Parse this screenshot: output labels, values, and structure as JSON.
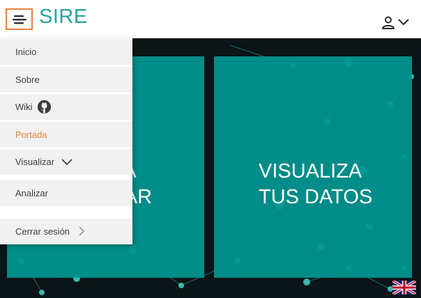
{
  "header": {
    "brand": "SIRE",
    "menu_icon": "hamburger-menu-icon",
    "user_icon": "user-icon",
    "user_dropdown_icon": "chevron-down-icon",
    "accent_color": "#e8833a",
    "brand_color": "#2aa1a1"
  },
  "side_menu": {
    "items": [
      {
        "label": "Inicio"
      },
      {
        "label": "Sobre"
      },
      {
        "label": "Wiki",
        "icon": "github-icon"
      },
      {
        "label": "Portada",
        "active": true
      },
      {
        "label": "Visualizar",
        "icon": "chevron-down-icon"
      },
      {
        "label": "Analizar"
      },
      {
        "label": "Cerrar sesión",
        "icon": "chevron-right-icon"
      }
    ]
  },
  "tiles": {
    "left": {
      "line1": "A A",
      "line2": "IZAR"
    },
    "right": {
      "line1": "VISUALIZA",
      "line2": "TUS DATOS"
    }
  },
  "language": {
    "icon": "uk-flag-icon"
  },
  "colors": {
    "tile": "#009691",
    "hero_background": "#0b1416",
    "menu_background": "#f1f1f1"
  }
}
